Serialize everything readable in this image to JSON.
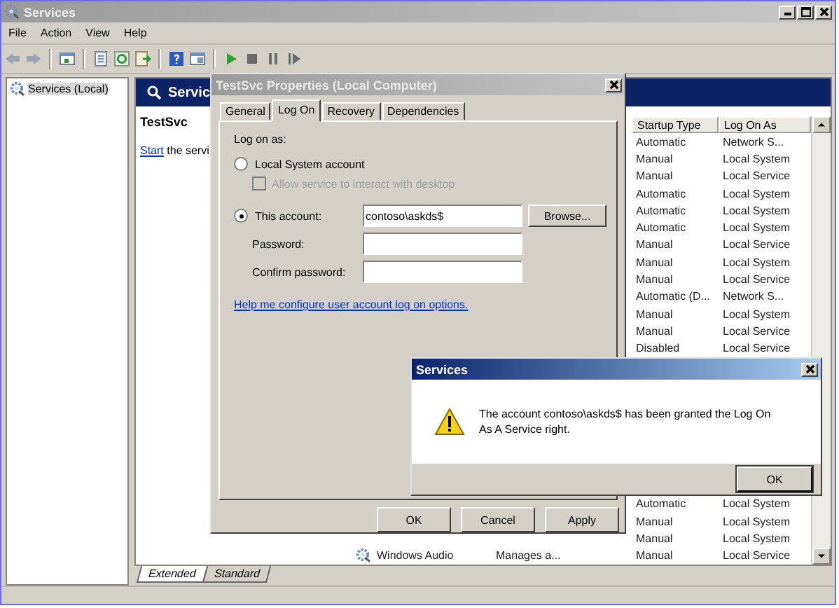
{
  "window": {
    "title": "Services",
    "menu": [
      "File",
      "Action",
      "View",
      "Help"
    ]
  },
  "tree": {
    "items": [
      {
        "label": "Services (Local)",
        "selected": true
      }
    ]
  },
  "pane": {
    "header": "Servic",
    "service_name": "TestSvc",
    "start_link": "Start",
    "start_text": "the servi"
  },
  "list": {
    "columns": [
      "Startup Type",
      "Log On As"
    ],
    "rows_top": [
      {
        "startup": "Automatic",
        "logon": "Network S..."
      },
      {
        "startup": "Manual",
        "logon": "Local System"
      },
      {
        "startup": "Manual",
        "logon": "Local Service"
      },
      {
        "startup": "Automatic",
        "logon": "Local System"
      },
      {
        "startup": "Automatic",
        "logon": "Local System"
      },
      {
        "startup": "Automatic",
        "logon": "Local System"
      },
      {
        "startup": "Manual",
        "logon": "Local Service"
      },
      {
        "startup": "Manual",
        "logon": "Local System"
      },
      {
        "startup": "Manual",
        "logon": "Local Service"
      },
      {
        "startup": "Automatic (D...",
        "logon": "Network S..."
      },
      {
        "startup": "Manual",
        "logon": "Local System"
      },
      {
        "startup": "Manual",
        "logon": "Local Service"
      },
      {
        "startup": "Disabled",
        "logon": "Local Service"
      }
    ],
    "rows_bottom": [
      {
        "startup": "Automatic",
        "logon": "Local System"
      },
      {
        "startup": "Manual",
        "logon": "Local System"
      },
      {
        "startup": "Manual",
        "logon": "Local System"
      },
      {
        "name": "Windows Audio",
        "description": "Manages a...",
        "startup": "Manual",
        "logon": "Local Service"
      }
    ]
  },
  "view_tabs": [
    {
      "label": "Extended",
      "selected": true
    },
    {
      "label": "Standard",
      "selected": false
    }
  ],
  "properties": {
    "title": "TestSvc Properties (Local Computer)",
    "tabs": [
      {
        "label": "General",
        "selected": false
      },
      {
        "label": "Log On",
        "selected": true
      },
      {
        "label": "Recovery",
        "selected": false
      },
      {
        "label": "Dependencies",
        "selected": false
      }
    ],
    "log_on_as_label": "Log on as:",
    "options": [
      {
        "label": "Local System account",
        "selected": false
      },
      {
        "label": "This account:",
        "selected": true
      }
    ],
    "interact": {
      "label": "Allow service to interact with desktop",
      "checked": false,
      "disabled": true
    },
    "account": {
      "value": "contoso\\askds$"
    },
    "browse": "Browse...",
    "password_label": "Password:",
    "confirm_label": "Confirm password:",
    "help_link": "Help me configure user account log on options.",
    "buttons": [
      "OK",
      "Cancel",
      "Apply"
    ]
  },
  "message": {
    "title": "Services",
    "text": "The account contoso\\askds$ has been granted the Log On As A Service right.",
    "button": "OK"
  }
}
